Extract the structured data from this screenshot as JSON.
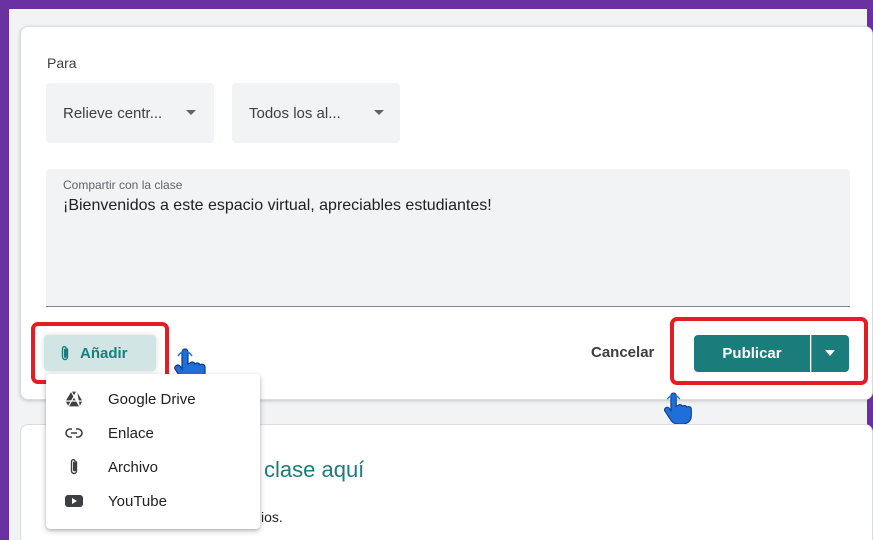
{
  "composer": {
    "to_label": "Para",
    "class_select": "Relieve centr...",
    "students_select": "Todos los al...",
    "share_label": "Compartir con la clase",
    "share_text": "¡Bienvenidos a este espacio virtual, apreciables estudiantes!",
    "add_label": "Añadir",
    "cancel_label": "Cancelar",
    "publish_label": "Publicar"
  },
  "attach_menu": {
    "items": [
      {
        "label": "Google Drive",
        "icon": "google-drive-icon"
      },
      {
        "label": "Enlace",
        "icon": "link-icon"
      },
      {
        "label": "Archivo",
        "icon": "paperclip-icon"
      },
      {
        "label": "YouTube",
        "icon": "youtube-icon"
      }
    ]
  },
  "background_card": {
    "heading_fragment": "clase aquí",
    "body_fragment": "ios."
  },
  "colors": {
    "frame": "#6a2fa1",
    "accent": "#1a7d7c",
    "highlight": "#e41c24",
    "hand": "#1e6fd9"
  }
}
